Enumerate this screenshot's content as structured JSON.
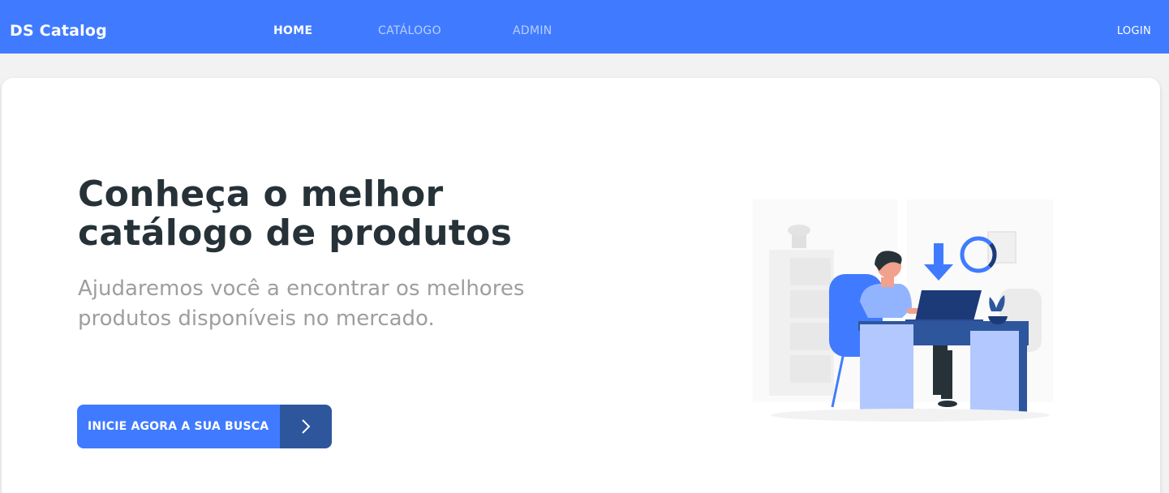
{
  "navbar": {
    "brand": "DS Catalog",
    "links": [
      {
        "label": "HOME",
        "active": true
      },
      {
        "label": "CATÁLOGO",
        "active": false
      },
      {
        "label": "ADMIN",
        "active": false
      }
    ],
    "login_label": "LOGIN"
  },
  "hero": {
    "title_line1": "Conheça o melhor",
    "title_line2": "catálogo de produtos",
    "subtitle_line1": "Ajudaremos você a encontrar os melhores",
    "subtitle_line2": "produtos disponíveis no mercado.",
    "cta_label": "INICIE AGORA A SUA BUSCA",
    "cta_icon": "chevron-right-icon"
  },
  "colors": {
    "primary": "#407bff",
    "primary_dark": "#2e569c",
    "heading": "#263238",
    "subtitle": "#9e9e9e",
    "background": "#f2f2f2"
  }
}
